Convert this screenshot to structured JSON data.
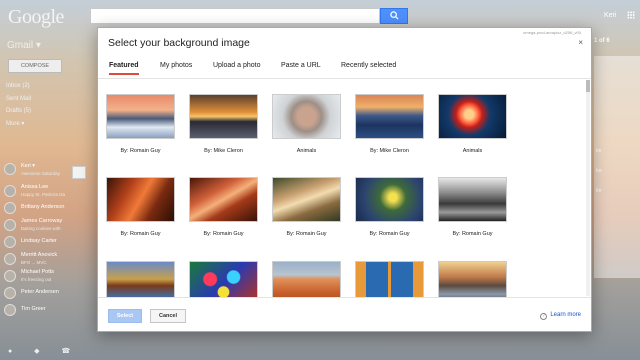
{
  "header": {
    "logo": "Google",
    "user_name": "Keri"
  },
  "sidebar": {
    "gmail_label": "Gmail ▾",
    "compose_label": "COMPOSE",
    "nav_items": [
      "Inbox (2)",
      "Sent Mail",
      "Drafts (5)",
      "More ▾"
    ],
    "me": {
      "name": "Keri ▾",
      "status": "Awesome Saturday"
    },
    "contacts": [
      {
        "name": "Anissa Lee",
        "status": "Happy St. Patricks Da"
      },
      {
        "name": "Brittany Anderson",
        "status": ""
      },
      {
        "name": "James Carroway",
        "status": "Baking cookies with"
      },
      {
        "name": "Lindsay Carter",
        "status": ""
      },
      {
        "name": "Merritt Anovick",
        "status": "BFO ... MVC"
      },
      {
        "name": "Michael Potts",
        "status": "It's freezing out"
      },
      {
        "name": "Peter Andersen",
        "status": ""
      },
      {
        "name": "Tim Greer",
        "status": ""
      }
    ]
  },
  "right_panel": {
    "page_info": "1 of 6",
    "lines": [
      "ile",
      "ke",
      "ile"
    ]
  },
  "dialog": {
    "id_text": "omega-prod-anrapisz_d256_v00",
    "title": "Select your background image",
    "close_label": "×",
    "tabs": [
      "Featured",
      "My photos",
      "Upload a photo",
      "Paste a URL",
      "Recently selected"
    ],
    "select_label": "Select",
    "cancel_label": "Cancel",
    "learn_more": "Learn more",
    "help_glyph": "?"
  },
  "images": [
    {
      "caption": "By: Romain Guy",
      "scene": "icy-river-sunset"
    },
    {
      "caption": "By: Mike Cleron",
      "scene": "sunset-coast"
    },
    {
      "caption": "Animals",
      "scene": "snow-monkey"
    },
    {
      "caption": "By: Mike Cleron",
      "scene": "blue-dusk"
    },
    {
      "caption": "Animals",
      "scene": "jellyfish"
    },
    {
      "caption": "By: Romain Guy",
      "scene": "red-canyon"
    },
    {
      "caption": "By: Romain Guy",
      "scene": "slot-canyon"
    },
    {
      "caption": "By: Romain Guy",
      "scene": "wood-bench"
    },
    {
      "caption": "By: Romain Guy",
      "scene": "yellow-flowers"
    },
    {
      "caption": "By: Romain Guy",
      "scene": "bw-landscape"
    },
    {
      "caption": "",
      "scene": "autumn-lake"
    },
    {
      "caption": "",
      "scene": "glass-sculpture"
    },
    {
      "caption": "",
      "scene": "desert-dune"
    },
    {
      "caption": "",
      "scene": "blue-window"
    },
    {
      "caption": "",
      "scene": "rock-coast"
    }
  ]
}
